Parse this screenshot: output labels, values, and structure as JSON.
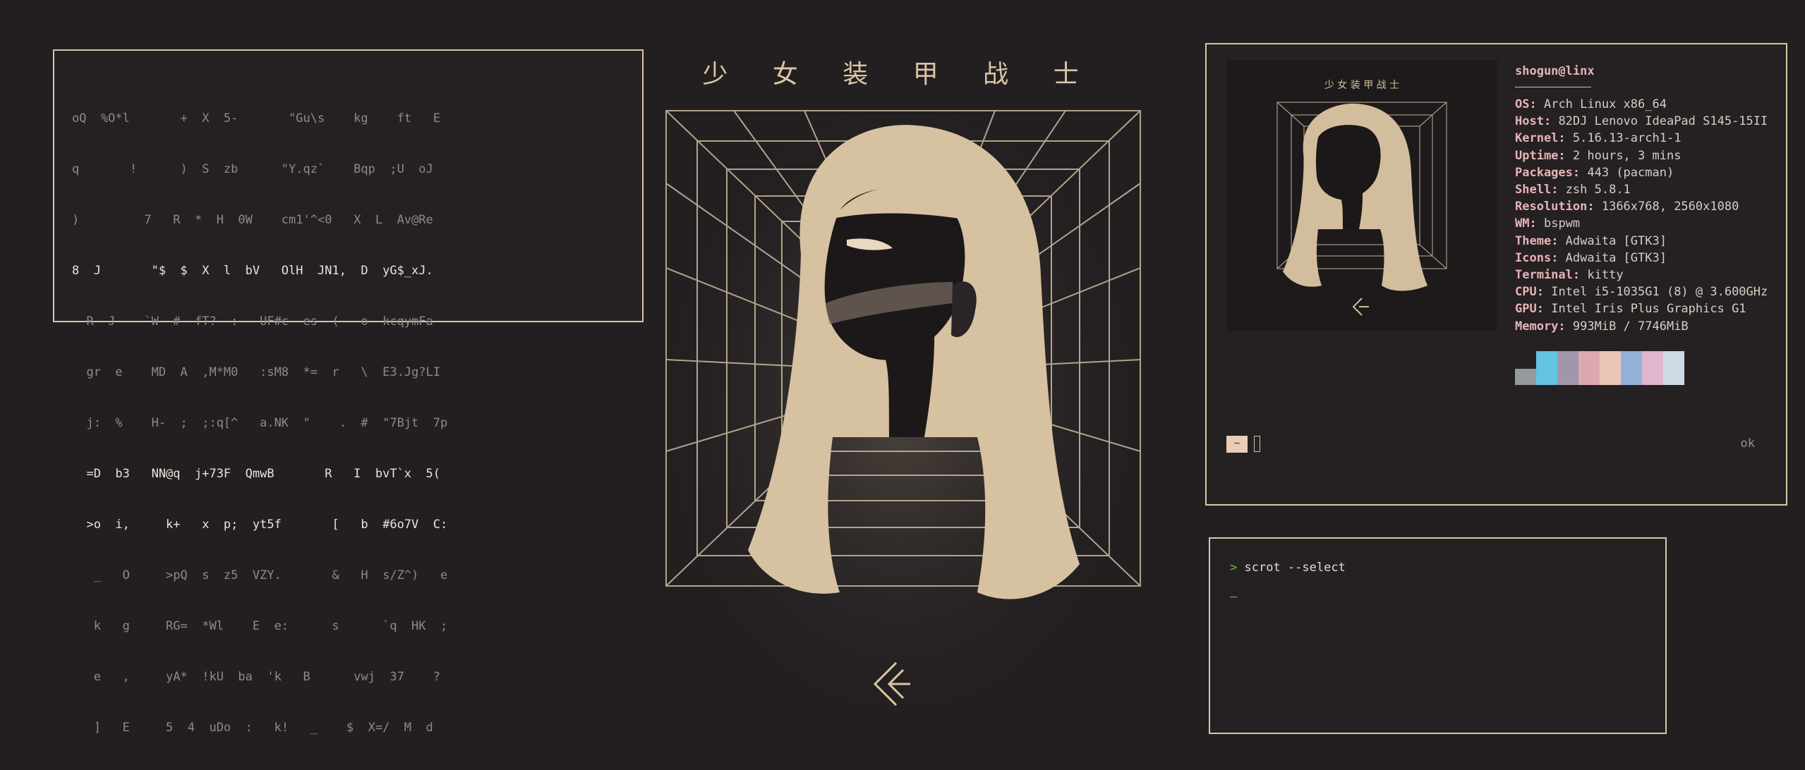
{
  "matrix": {
    "rows": [
      "oQ  %O*l       +  X  5-       \"Gu\\s    kg    ft   E",
      "q       !      )  S  zb      \"Y.qz`    Bqp  ;U  oJ",
      ")         7   R  *  H  0W    cm1'^<0   X  L  Av@Re",
      "8  J       \"$  $  X  l  bV   OlH  JN1,  D  yG$_xJ.",
      "  R  J    `W  #  fT?  :   UF#c  es  (   o  kcqymFa",
      "  gr  e    MD  A  ,M*M0   :sM8  *=  r   \\  E3.Jg?LI",
      "  j:  %    H-  ;  ;:q[^   a.NK  \"    .  #  \"7Bjt  7p",
      "  =D  b3   NN@q  j+73F  QmwB       R   I  bvT`x  5(",
      "  >o  i,     k+   x  p;  yt5f       [   b  #6o7V  C:",
      "   _   O     >pQ  s  z5  VZY.       &   H  s/Z^)   e",
      "   k   g     RG=  *Wl    E  e:      s      `q  HK  ;",
      "   e   ,     yA*  !kU  ba  'k   B      vwj  37    ?",
      "   ]   E     5  4  uDo  :   k!   _    $  X=/  M  d"
    ]
  },
  "wallpaper": {
    "title": "少 女 装 甲 战 士"
  },
  "neofetch": {
    "user_host": "shogun@linx",
    "info": [
      {
        "label": "OS",
        "value": "Arch Linux x86_64"
      },
      {
        "label": "Host",
        "value": "82DJ Lenovo IdeaPad S145-15II"
      },
      {
        "label": "Kernel",
        "value": "5.16.13-arch1-1"
      },
      {
        "label": "Uptime",
        "value": "2 hours, 3 mins"
      },
      {
        "label": "Packages",
        "value": "443 (pacman)"
      },
      {
        "label": "Shell",
        "value": "zsh 5.8.1"
      },
      {
        "label": "Resolution",
        "value": "1366x768, 2560x1080"
      },
      {
        "label": "WM",
        "value": "bspwm"
      },
      {
        "label": "Theme",
        "value": "Adwaita [GTK3]"
      },
      {
        "label": "Icons",
        "value": "Adwaita [GTK3]"
      },
      {
        "label": "Terminal",
        "value": "kitty"
      },
      {
        "label": "CPU",
        "value": "Intel i5-1035G1 (8) @ 3.600GHz"
      },
      {
        "label": "GPU",
        "value": "Intel Iris Plus Graphics G1"
      },
      {
        "label": "Memory",
        "value": "993MiB / 7746MiB"
      }
    ],
    "palette": [
      "#94999e",
      "#64c3e0",
      "#a197a8",
      "#dca9b3",
      "#e8c7b5",
      "#94b0d8",
      "#deb6cd",
      "#cfdae6"
    ],
    "prompt_symbol": "~",
    "status": "ok"
  },
  "terminal": {
    "prompt_arrow": ">",
    "command": "scrot --select",
    "cursor": "_"
  },
  "colors": {
    "background": "#231f21",
    "border": "#d9c6a3",
    "accent_pink": "#e6b4b8",
    "prompt_green": "#74b84a"
  }
}
